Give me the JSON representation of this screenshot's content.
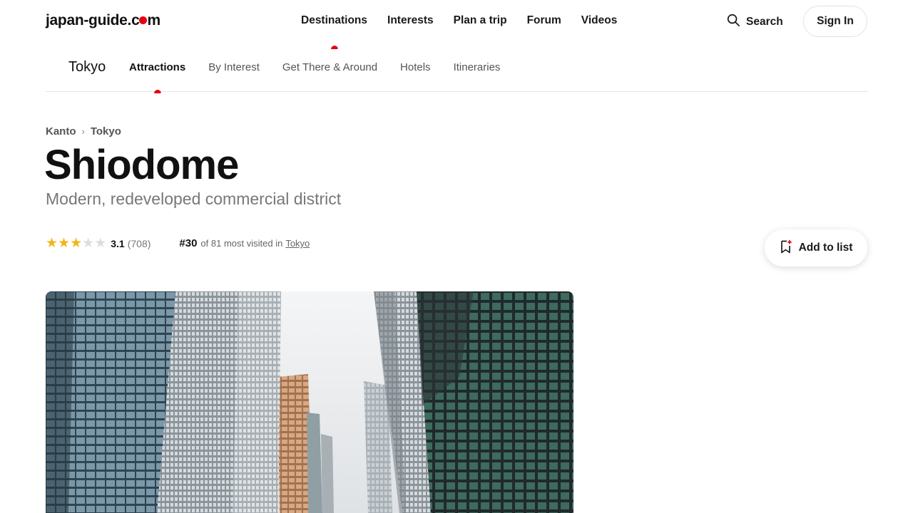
{
  "header": {
    "logo_text_a": "japan-guide.c",
    "logo_text_b": "m",
    "nav": [
      "Destinations",
      "Interests",
      "Plan a trip",
      "Forum",
      "Videos"
    ],
    "active_nav": "Destinations",
    "search_label": "Search",
    "signin_label": "Sign In"
  },
  "subnav": {
    "city": "Tokyo",
    "tabs": [
      "Attractions",
      "By Interest",
      "Get There & Around",
      "Hotels",
      "Itineraries"
    ],
    "active_tab": "Attractions"
  },
  "breadcrumb": {
    "items": [
      "Kanto",
      "Tokyo"
    ],
    "separator": "›"
  },
  "page": {
    "title": "Shiodome",
    "subtitle": "Modern, redeveloped commercial district"
  },
  "rating": {
    "stars_value": 3.1,
    "value": "3.1",
    "count": "(708)",
    "rank": "#30",
    "rank_text": "of 81 most visited in",
    "rank_link": "Tokyo"
  },
  "actions": {
    "add_to_list": "Add to list"
  },
  "colors": {
    "accent": "#e60012",
    "star": "#f3b417"
  }
}
